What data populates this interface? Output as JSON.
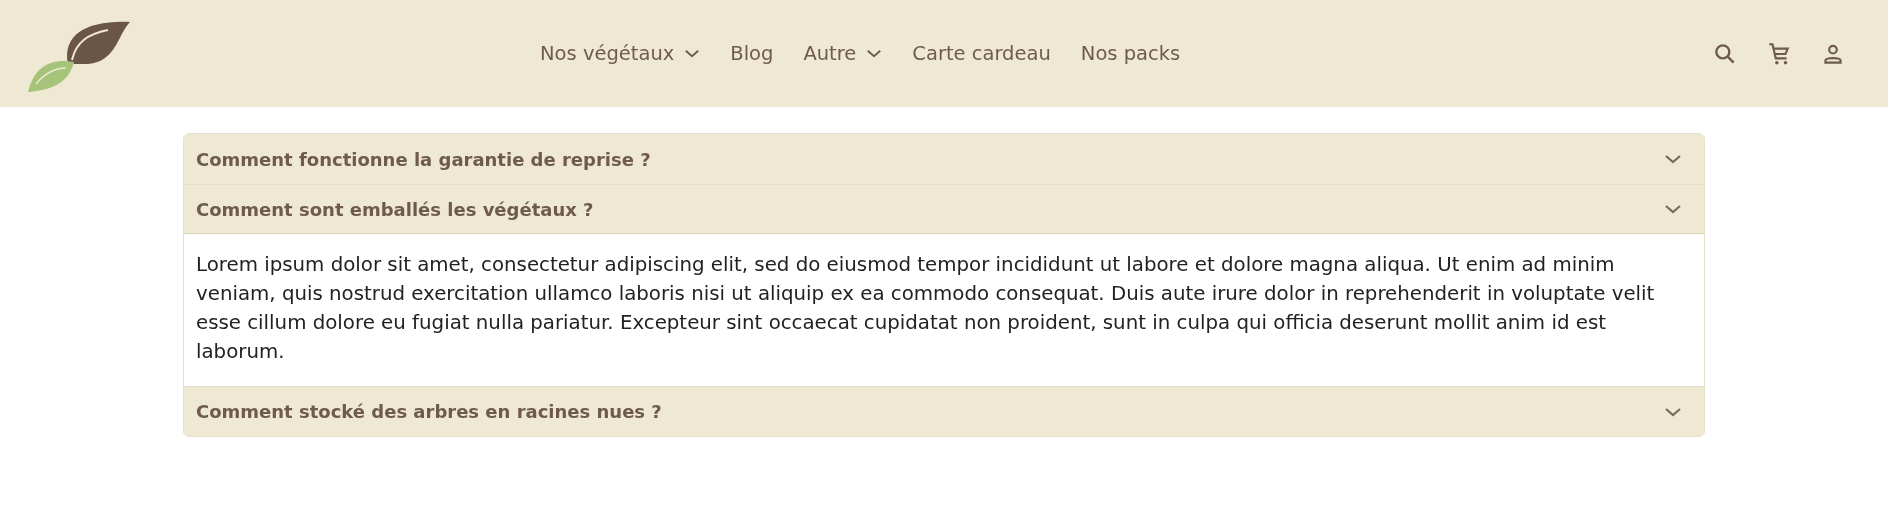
{
  "nav": [
    {
      "label": "Nos végétaux",
      "dropdown": true
    },
    {
      "label": "Blog",
      "dropdown": false
    },
    {
      "label": "Autre",
      "dropdown": true
    },
    {
      "label": "Carte cardeau",
      "dropdown": false
    },
    {
      "label": "Nos packs",
      "dropdown": false
    }
  ],
  "faq": [
    {
      "question": "Comment fonctionne la garantie de reprise ?",
      "expanded": false
    },
    {
      "question": "Comment sont emballés les végétaux ?",
      "expanded": true,
      "answer": "Lorem ipsum dolor sit amet, consectetur adipiscing elit, sed do eiusmod tempor incididunt ut labore et dolore magna aliqua. Ut enim ad minim veniam, quis nostrud exercitation ullamco laboris nisi ut aliquip ex ea commodo consequat. Duis aute irure dolor in reprehenderit in voluptate velit esse cillum dolore eu fugiat nulla pariatur. Excepteur sint occaecat cupidatat non proident, sunt in culpa qui officia deserunt mollit anim id est laborum."
    },
    {
      "question": "Comment stocké des arbres en racines nues ?",
      "expanded": false
    }
  ]
}
